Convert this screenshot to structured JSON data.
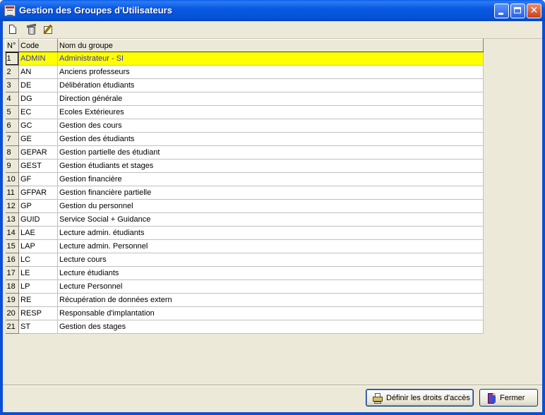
{
  "window": {
    "title": "Gestion des Groupes d'Utilisateurs",
    "close_glyph": "✕"
  },
  "toolbar": {
    "icons": [
      "new-document-icon",
      "delete-icon",
      "edit-icon"
    ]
  },
  "table": {
    "headers": [
      "N°",
      "Code",
      "Nom du groupe"
    ],
    "selected_row": 0,
    "selection_color": "#ffff00",
    "rows": [
      {
        "num": "1",
        "code": "ADMIN",
        "name": "Administrateur - SI"
      },
      {
        "num": "2",
        "code": "AN",
        "name": "Anciens professeurs"
      },
      {
        "num": "3",
        "code": "DE",
        "name": "Délibération étudiants"
      },
      {
        "num": "4",
        "code": "DG",
        "name": "Direction générale"
      },
      {
        "num": "5",
        "code": "EC",
        "name": "Ecoles Extérieures"
      },
      {
        "num": "6",
        "code": "GC",
        "name": "Gestion des cours"
      },
      {
        "num": "7",
        "code": "GE",
        "name": "Gestion des étudiants"
      },
      {
        "num": "8",
        "code": "GEPAR",
        "name": "Gestion partielle des étudiant"
      },
      {
        "num": "9",
        "code": "GEST",
        "name": "Gestion étudiants et stages"
      },
      {
        "num": "10",
        "code": "GF",
        "name": "Gestion financière"
      },
      {
        "num": "11",
        "code": "GFPAR",
        "name": "Gestion financière partielle"
      },
      {
        "num": "12",
        "code": "GP",
        "name": "Gestion du personnel"
      },
      {
        "num": "13",
        "code": "GUID",
        "name": "Service Social + Guidance"
      },
      {
        "num": "14",
        "code": "LAE",
        "name": "Lecture admin. étudiants"
      },
      {
        "num": "15",
        "code": "LAP",
        "name": "Lecture admin. Personnel"
      },
      {
        "num": "16",
        "code": "LC",
        "name": "Lecture cours"
      },
      {
        "num": "17",
        "code": "LE",
        "name": "Lecture étudiants"
      },
      {
        "num": "18",
        "code": "LP",
        "name": "Lecture Personnel"
      },
      {
        "num": "19",
        "code": "RE",
        "name": "Récupération de données extern"
      },
      {
        "num": "20",
        "code": "RESP",
        "name": "Responsable d'implantation"
      },
      {
        "num": "21",
        "code": "ST",
        "name": "Gestion des stages"
      }
    ]
  },
  "buttons": {
    "define_rights": "Définir les droits d'accès",
    "close": "Fermer"
  }
}
